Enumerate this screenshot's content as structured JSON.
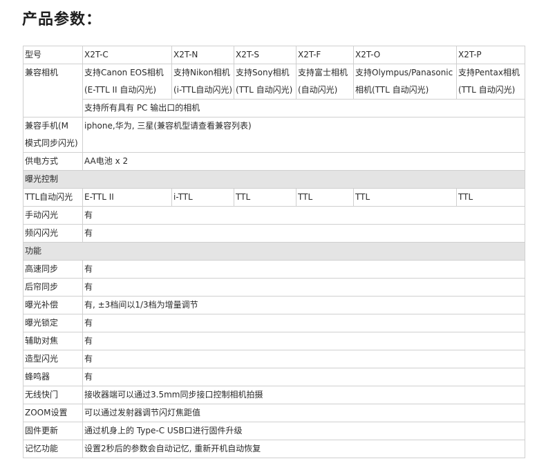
{
  "title": "产品参数：",
  "table": {
    "header": {
      "label": "型号",
      "models": [
        "X2T-C",
        "X2T-N",
        "X2T-S",
        "X2T-F",
        "X2T-O",
        "X2T-P"
      ]
    },
    "compat_camera": {
      "label": "兼容相机",
      "cells": [
        [
          "支持Canon EOS相机",
          "(E-TTL II 自动闪光)"
        ],
        [
          "支持Nikon相机",
          "(i-TTL自动闪光)"
        ],
        [
          "支持Sony相机",
          "(TTL 自动闪光)"
        ],
        [
          "支持富士相机",
          "(自动闪光)"
        ],
        [
          "支持Olympus/Panasonic",
          "相机(TTL 自动闪光)"
        ],
        [
          "支持Pentax相机",
          "(TTL 自动闪光)"
        ]
      ],
      "extra": "支持所有具有 PC 输出口的相机"
    },
    "compat_phone": {
      "label_lines": [
        "兼容手机(M",
        "模式同步闪光)"
      ],
      "value": "iphone,华为, 三星(兼容机型请查看兼容列表)"
    },
    "power": {
      "label": "供电方式",
      "value": "AA电池 x 2"
    },
    "section_exposure": "曝光控制",
    "ttl": {
      "label": "TTL自动闪光",
      "values": [
        "E-TTL II",
        "i-TTL",
        "TTL",
        "TTL",
        "TTL",
        "TTL"
      ]
    },
    "manual": {
      "label": "手动闪光",
      "value": "有"
    },
    "strobe": {
      "label": "频闪闪光",
      "value": "有"
    },
    "section_function": "功能",
    "features": [
      {
        "label": "高速同步",
        "value": "有"
      },
      {
        "label": "后帘同步",
        "value": "有"
      },
      {
        "label": "曝光补偿",
        "value": "有, ±3档间以1/3档为增量调节"
      },
      {
        "label": "曝光锁定",
        "value": "有"
      },
      {
        "label": "辅助对焦",
        "value": "有"
      },
      {
        "label": "造型闪光",
        "value": "有"
      },
      {
        "label": "蜂鸣器",
        "value": "有"
      },
      {
        "label": "无线快门",
        "value": "接收器端可以通过3.5mm同步接口控制相机拍摄"
      },
      {
        "label": "ZOOM设置",
        "value": "可以通过发射器调节闪灯焦距值"
      },
      {
        "label": "固件更新",
        "value": "通过机身上的 Type-C USB口进行固件升级"
      },
      {
        "label": "记忆功能",
        "value": "设置2秒后的参数会自动记忆, 重新开机自动恢复"
      }
    ]
  }
}
